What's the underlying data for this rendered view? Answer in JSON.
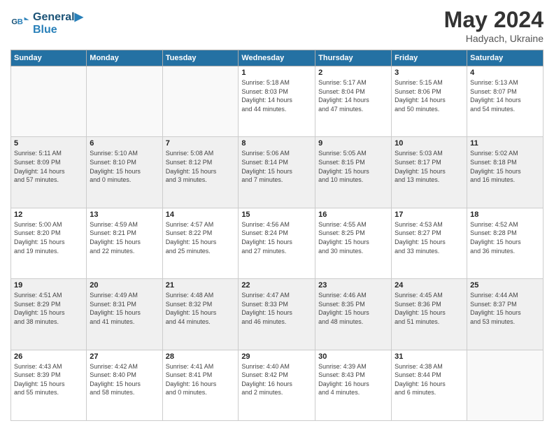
{
  "header": {
    "logo_line1": "General",
    "logo_line2": "Blue",
    "month_year": "May 2024",
    "location": "Hadyach, Ukraine"
  },
  "weekdays": [
    "Sunday",
    "Monday",
    "Tuesday",
    "Wednesday",
    "Thursday",
    "Friday",
    "Saturday"
  ],
  "weeks": [
    [
      {
        "day": "",
        "info": ""
      },
      {
        "day": "",
        "info": ""
      },
      {
        "day": "",
        "info": ""
      },
      {
        "day": "1",
        "info": "Sunrise: 5:18 AM\nSunset: 8:03 PM\nDaylight: 14 hours\nand 44 minutes."
      },
      {
        "day": "2",
        "info": "Sunrise: 5:17 AM\nSunset: 8:04 PM\nDaylight: 14 hours\nand 47 minutes."
      },
      {
        "day": "3",
        "info": "Sunrise: 5:15 AM\nSunset: 8:06 PM\nDaylight: 14 hours\nand 50 minutes."
      },
      {
        "day": "4",
        "info": "Sunrise: 5:13 AM\nSunset: 8:07 PM\nDaylight: 14 hours\nand 54 minutes."
      }
    ],
    [
      {
        "day": "5",
        "info": "Sunrise: 5:11 AM\nSunset: 8:09 PM\nDaylight: 14 hours\nand 57 minutes."
      },
      {
        "day": "6",
        "info": "Sunrise: 5:10 AM\nSunset: 8:10 PM\nDaylight: 15 hours\nand 0 minutes."
      },
      {
        "day": "7",
        "info": "Sunrise: 5:08 AM\nSunset: 8:12 PM\nDaylight: 15 hours\nand 3 minutes."
      },
      {
        "day": "8",
        "info": "Sunrise: 5:06 AM\nSunset: 8:14 PM\nDaylight: 15 hours\nand 7 minutes."
      },
      {
        "day": "9",
        "info": "Sunrise: 5:05 AM\nSunset: 8:15 PM\nDaylight: 15 hours\nand 10 minutes."
      },
      {
        "day": "10",
        "info": "Sunrise: 5:03 AM\nSunset: 8:17 PM\nDaylight: 15 hours\nand 13 minutes."
      },
      {
        "day": "11",
        "info": "Sunrise: 5:02 AM\nSunset: 8:18 PM\nDaylight: 15 hours\nand 16 minutes."
      }
    ],
    [
      {
        "day": "12",
        "info": "Sunrise: 5:00 AM\nSunset: 8:20 PM\nDaylight: 15 hours\nand 19 minutes."
      },
      {
        "day": "13",
        "info": "Sunrise: 4:59 AM\nSunset: 8:21 PM\nDaylight: 15 hours\nand 22 minutes."
      },
      {
        "day": "14",
        "info": "Sunrise: 4:57 AM\nSunset: 8:22 PM\nDaylight: 15 hours\nand 25 minutes."
      },
      {
        "day": "15",
        "info": "Sunrise: 4:56 AM\nSunset: 8:24 PM\nDaylight: 15 hours\nand 27 minutes."
      },
      {
        "day": "16",
        "info": "Sunrise: 4:55 AM\nSunset: 8:25 PM\nDaylight: 15 hours\nand 30 minutes."
      },
      {
        "day": "17",
        "info": "Sunrise: 4:53 AM\nSunset: 8:27 PM\nDaylight: 15 hours\nand 33 minutes."
      },
      {
        "day": "18",
        "info": "Sunrise: 4:52 AM\nSunset: 8:28 PM\nDaylight: 15 hours\nand 36 minutes."
      }
    ],
    [
      {
        "day": "19",
        "info": "Sunrise: 4:51 AM\nSunset: 8:29 PM\nDaylight: 15 hours\nand 38 minutes."
      },
      {
        "day": "20",
        "info": "Sunrise: 4:49 AM\nSunset: 8:31 PM\nDaylight: 15 hours\nand 41 minutes."
      },
      {
        "day": "21",
        "info": "Sunrise: 4:48 AM\nSunset: 8:32 PM\nDaylight: 15 hours\nand 44 minutes."
      },
      {
        "day": "22",
        "info": "Sunrise: 4:47 AM\nSunset: 8:33 PM\nDaylight: 15 hours\nand 46 minutes."
      },
      {
        "day": "23",
        "info": "Sunrise: 4:46 AM\nSunset: 8:35 PM\nDaylight: 15 hours\nand 48 minutes."
      },
      {
        "day": "24",
        "info": "Sunrise: 4:45 AM\nSunset: 8:36 PM\nDaylight: 15 hours\nand 51 minutes."
      },
      {
        "day": "25",
        "info": "Sunrise: 4:44 AM\nSunset: 8:37 PM\nDaylight: 15 hours\nand 53 minutes."
      }
    ],
    [
      {
        "day": "26",
        "info": "Sunrise: 4:43 AM\nSunset: 8:39 PM\nDaylight: 15 hours\nand 55 minutes."
      },
      {
        "day": "27",
        "info": "Sunrise: 4:42 AM\nSunset: 8:40 PM\nDaylight: 15 hours\nand 58 minutes."
      },
      {
        "day": "28",
        "info": "Sunrise: 4:41 AM\nSunset: 8:41 PM\nDaylight: 16 hours\nand 0 minutes."
      },
      {
        "day": "29",
        "info": "Sunrise: 4:40 AM\nSunset: 8:42 PM\nDaylight: 16 hours\nand 2 minutes."
      },
      {
        "day": "30",
        "info": "Sunrise: 4:39 AM\nSunset: 8:43 PM\nDaylight: 16 hours\nand 4 minutes."
      },
      {
        "day": "31",
        "info": "Sunrise: 4:38 AM\nSunset: 8:44 PM\nDaylight: 16 hours\nand 6 minutes."
      },
      {
        "day": "",
        "info": ""
      }
    ]
  ]
}
